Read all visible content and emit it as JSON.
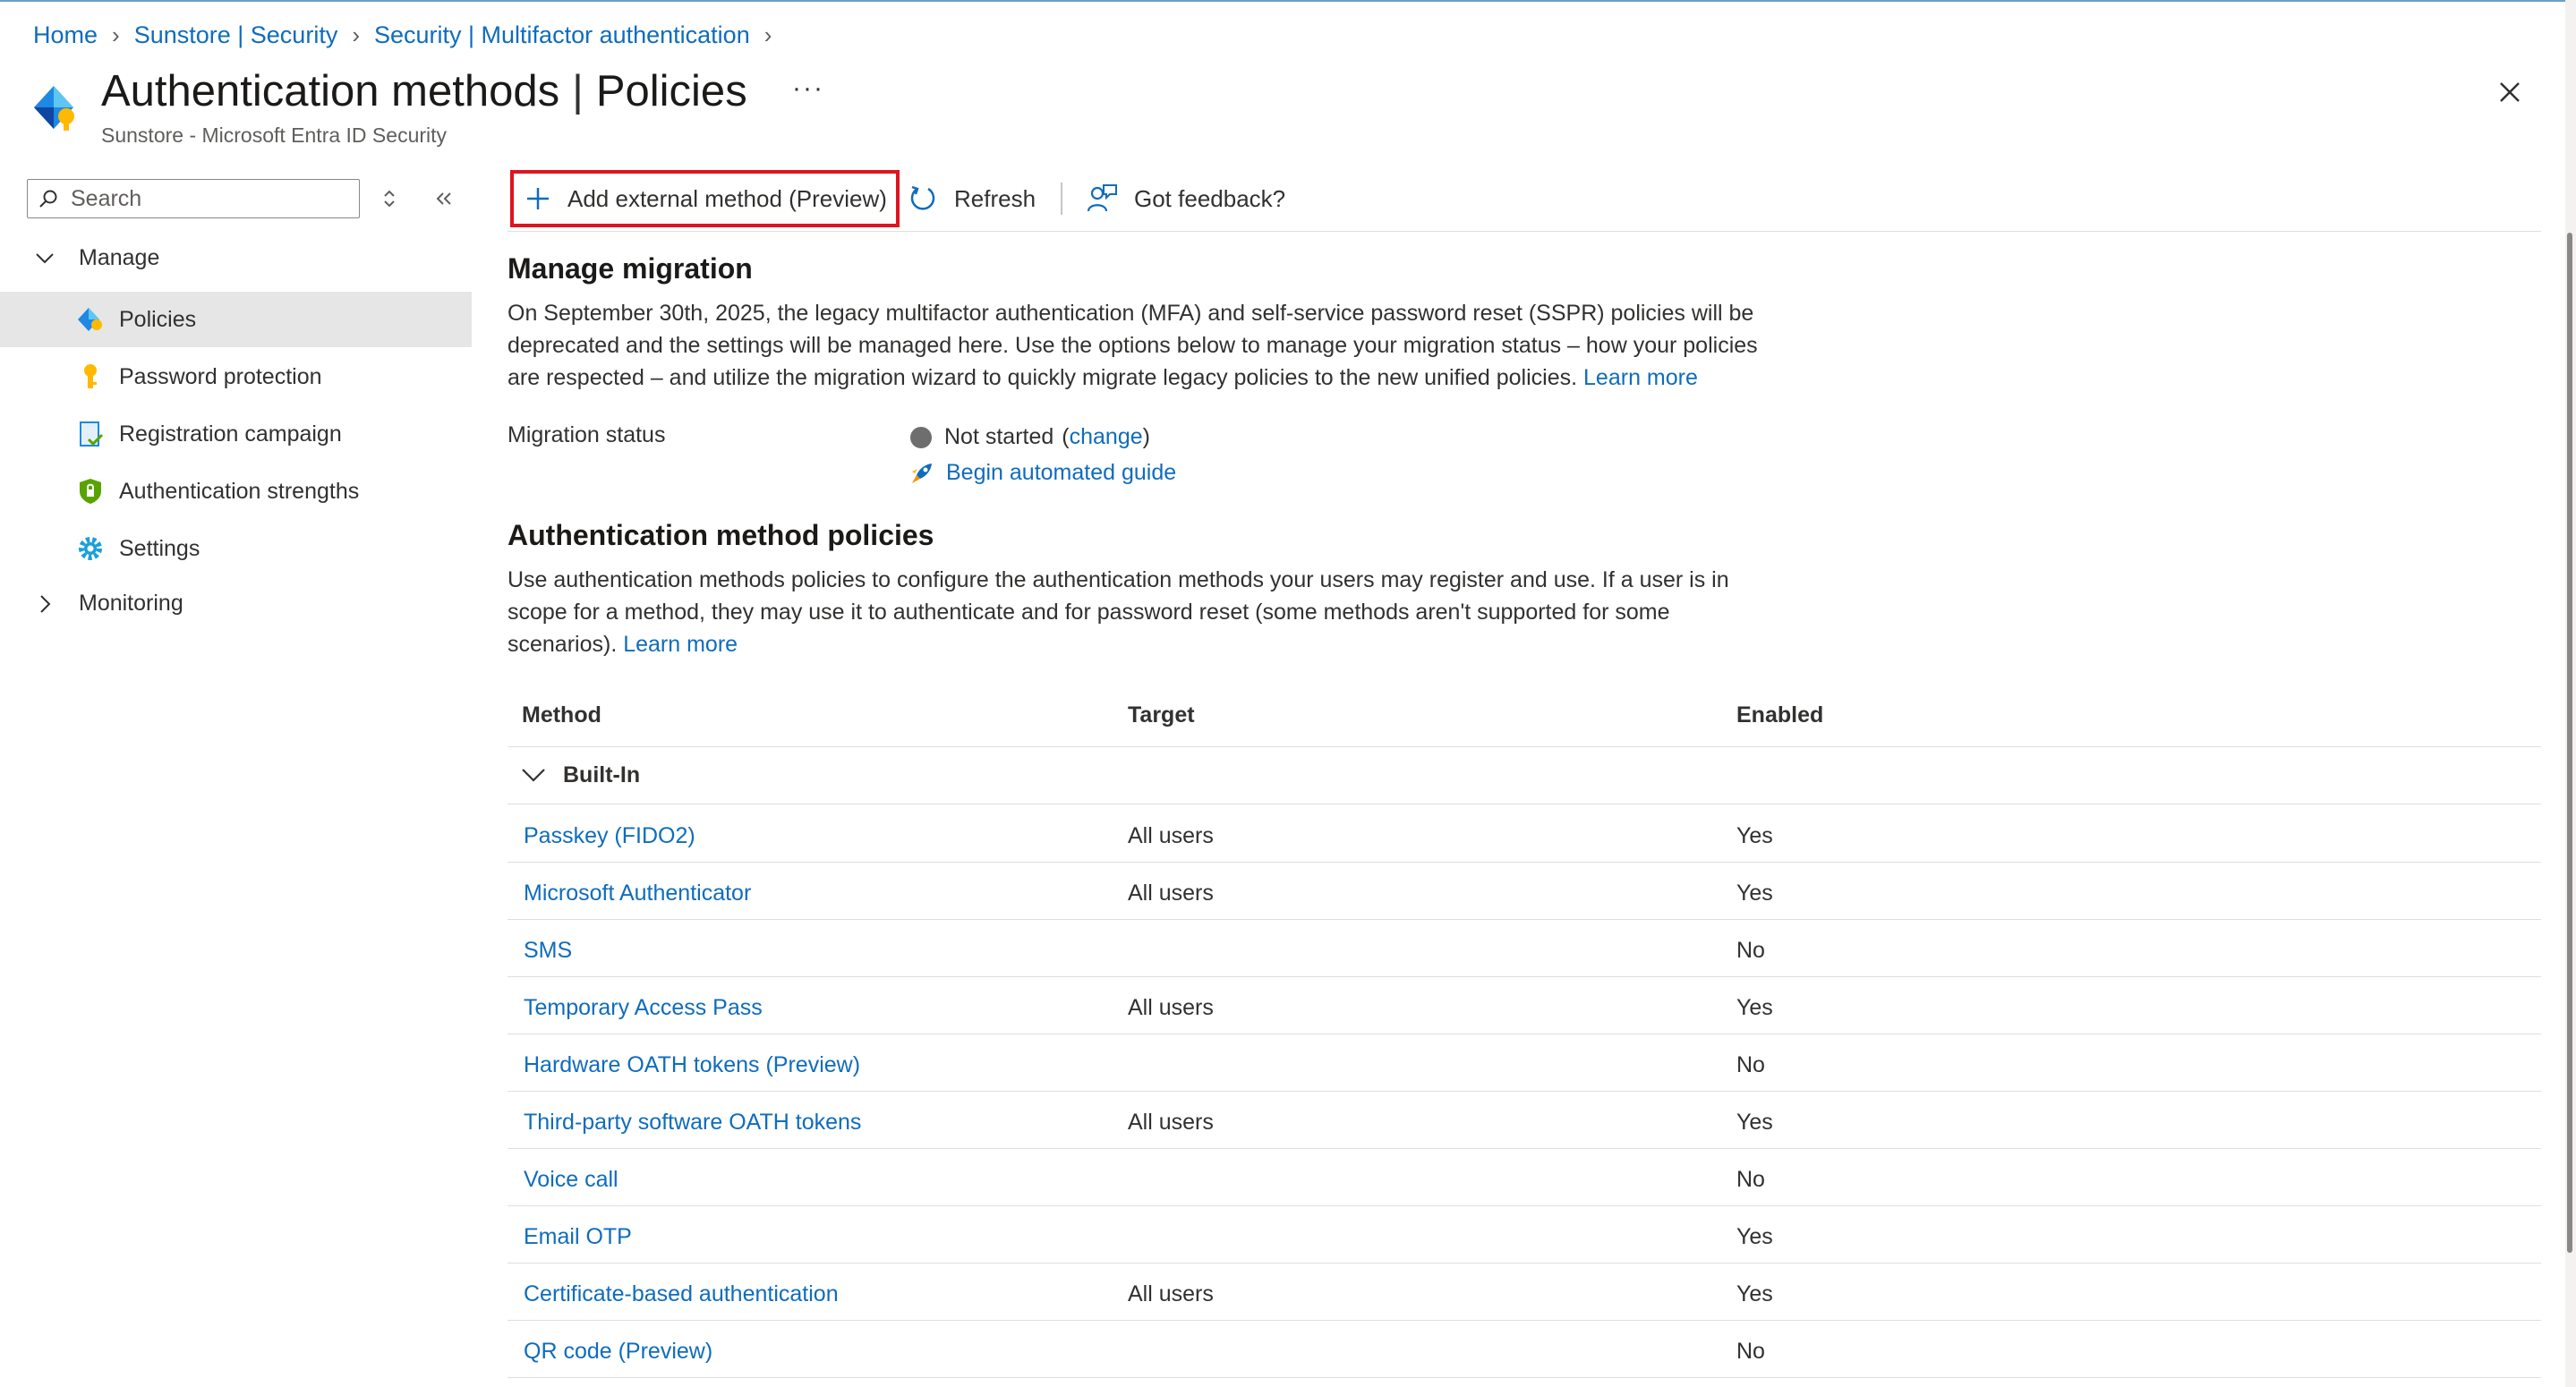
{
  "breadcrumb": [
    {
      "label": "Home"
    },
    {
      "label": "Sunstore | Security"
    },
    {
      "label": "Security | Multifactor authentication"
    }
  ],
  "header": {
    "title": "Authentication methods",
    "separator": "|",
    "section": "Policies",
    "more": "···",
    "subtitle": "Sunstore - Microsoft Entra ID Security"
  },
  "sidebar": {
    "search_placeholder": "Search",
    "manage_label": "Manage",
    "items": [
      {
        "label": "Policies",
        "icon": "policies-icon",
        "selected": true
      },
      {
        "label": "Password protection",
        "icon": "key-icon"
      },
      {
        "label": "Registration campaign",
        "icon": "registration-icon"
      },
      {
        "label": "Authentication strengths",
        "icon": "shield-icon"
      },
      {
        "label": "Settings",
        "icon": "gear-icon"
      }
    ],
    "monitoring_label": "Monitoring"
  },
  "toolbar": {
    "add_external": "Add external method (Preview)",
    "refresh": "Refresh",
    "feedback": "Got feedback?"
  },
  "migration": {
    "heading": "Manage migration",
    "body_line1": "On September 30th, 2025, the legacy multifactor authentication (MFA) and self-service password reset (SSPR) policies will be",
    "body_line2": "deprecated and the settings will be managed here. Use the options below to manage your migration status – how your policies",
    "body_line3": "are respected – and utilize the migration wizard to quickly migrate legacy policies to the new unified policies.",
    "learn_more": "Learn more",
    "status_label": "Migration status",
    "status_value": "Not started",
    "change_open": "(",
    "change_link": "change",
    "change_close": ")",
    "guide_link": "Begin automated guide"
  },
  "policies": {
    "heading": "Authentication method policies",
    "body_line1": "Use authentication methods policies to configure the authentication methods your users may register and use. If a user is in",
    "body_line2": "scope for a method, they may use it to authenticate and for password reset (some methods aren't supported for some",
    "body_line3": "scenarios).",
    "learn_more": "Learn more",
    "columns": {
      "method": "Method",
      "target": "Target",
      "enabled": "Enabled"
    },
    "group": "Built-In",
    "rows": [
      {
        "method": "Passkey (FIDO2)",
        "target": "All users",
        "enabled": "Yes"
      },
      {
        "method": "Microsoft Authenticator",
        "target": "All users",
        "enabled": "Yes"
      },
      {
        "method": "SMS",
        "target": "",
        "enabled": "No"
      },
      {
        "method": "Temporary Access Pass",
        "target": "All users",
        "enabled": "Yes"
      },
      {
        "method": "Hardware OATH tokens (Preview)",
        "target": "",
        "enabled": "No"
      },
      {
        "method": "Third-party software OATH tokens",
        "target": "All users",
        "enabled": "Yes"
      },
      {
        "method": "Voice call",
        "target": "",
        "enabled": "No"
      },
      {
        "method": "Email OTP",
        "target": "",
        "enabled": "Yes"
      },
      {
        "method": "Certificate-based authentication",
        "target": "All users",
        "enabled": "Yes"
      },
      {
        "method": "QR code (Preview)",
        "target": "",
        "enabled": "No"
      }
    ]
  },
  "colors": {
    "link": "#0f6cbd",
    "highlight_border": "#e0141e",
    "selected_nav": "#e6e6e6",
    "status_not_started": "#6e6e6e"
  }
}
